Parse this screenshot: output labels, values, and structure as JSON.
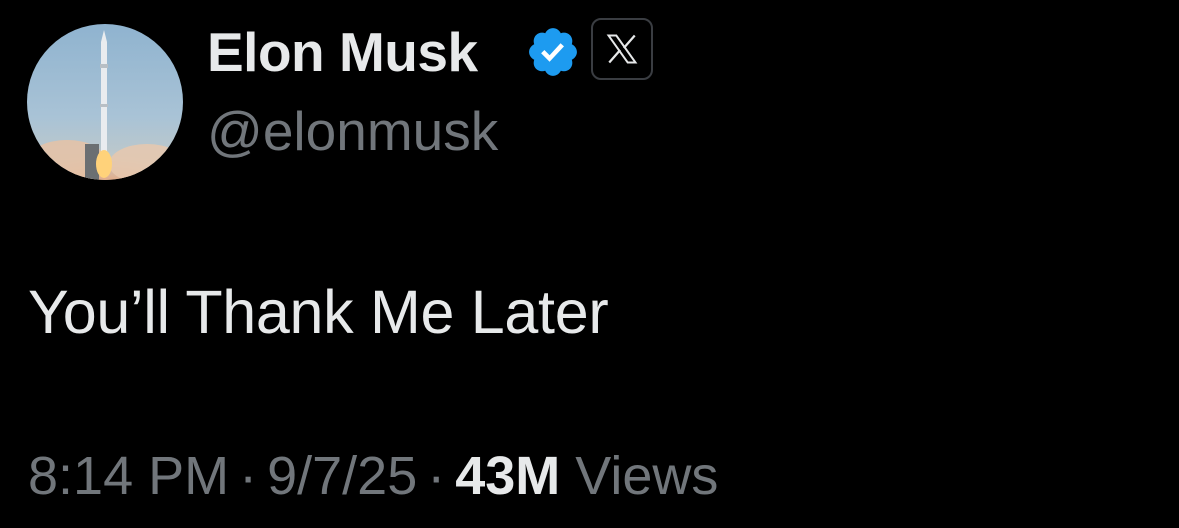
{
  "author": {
    "display_name": "Elon Musk",
    "handle": "@elonmusk",
    "verified_color": "#1d9bf0",
    "avatar_icon": "rocket-launch-avatar",
    "affiliate_icon": "x-logo-icon"
  },
  "tweet": {
    "text": "You’ll Thank Me Later"
  },
  "meta": {
    "time": "8:14 PM",
    "separator": "·",
    "date": "9/7/25",
    "views_count": "43M",
    "views_label": "Views"
  },
  "colors": {
    "background": "#000000",
    "primary_text": "#e7e9ea",
    "secondary_text": "#71767b",
    "accent": "#1d9bf0"
  }
}
